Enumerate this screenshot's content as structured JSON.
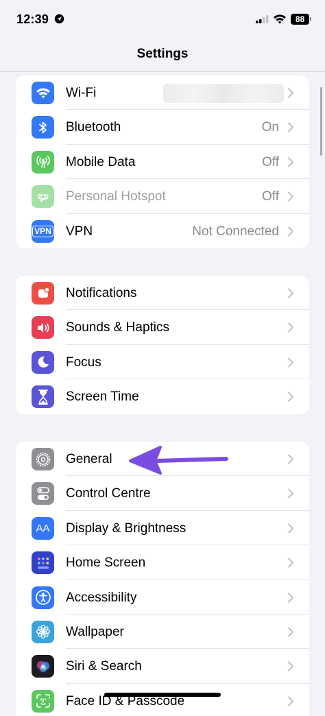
{
  "status_bar": {
    "time": "12:39",
    "battery": "88"
  },
  "nav": {
    "title": "Settings"
  },
  "group1": [
    {
      "label": "Wi-Fi",
      "value": "",
      "icon": "wifi-icon",
      "color": "#3478f6"
    },
    {
      "label": "Bluetooth",
      "value": "On",
      "icon": "bluetooth-icon",
      "color": "#3478f6"
    },
    {
      "label": "Mobile Data",
      "value": "Off",
      "icon": "antenna-icon",
      "color": "#5ac85e"
    },
    {
      "label": "Personal Hotspot",
      "value": "Off",
      "icon": "hotspot-icon",
      "color": "#5ac85e"
    },
    {
      "label": "VPN",
      "value": "Not Connected",
      "icon": "vpn-icon",
      "color": "#3478f6"
    }
  ],
  "group2": [
    {
      "label": "Notifications",
      "icon": "bell-icon",
      "color": "#ef4d45"
    },
    {
      "label": "Sounds & Haptics",
      "icon": "speaker-icon",
      "color": "#ea3d55"
    },
    {
      "label": "Focus",
      "icon": "moon-icon",
      "color": "#5a55d6"
    },
    {
      "label": "Screen Time",
      "icon": "hourglass-icon",
      "color": "#5a55d6"
    }
  ],
  "group3": [
    {
      "label": "General",
      "icon": "gear-icon",
      "color": "#8e8e93"
    },
    {
      "label": "Control Centre",
      "icon": "toggles-icon",
      "color": "#8e8e93"
    },
    {
      "label": "Display & Brightness",
      "icon": "aa-icon",
      "color": "#3478f6",
      "icon_text": "AA"
    },
    {
      "label": "Home Screen",
      "icon": "home-grid-icon",
      "color": "#3340c9"
    },
    {
      "label": "Accessibility",
      "icon": "accessibility-icon",
      "color": "#3478f6"
    },
    {
      "label": "Wallpaper",
      "icon": "flower-icon",
      "color": "#3aa4d9"
    },
    {
      "label": "Siri & Search",
      "icon": "siri-icon",
      "color": "#1c1c1e"
    },
    {
      "label": "Face ID & Passcode",
      "icon": "faceid-icon",
      "color": "#5ac85e"
    }
  ],
  "vpn_icon_text": "VPN",
  "annotation": {
    "arrow_color": "#7a4de0"
  }
}
